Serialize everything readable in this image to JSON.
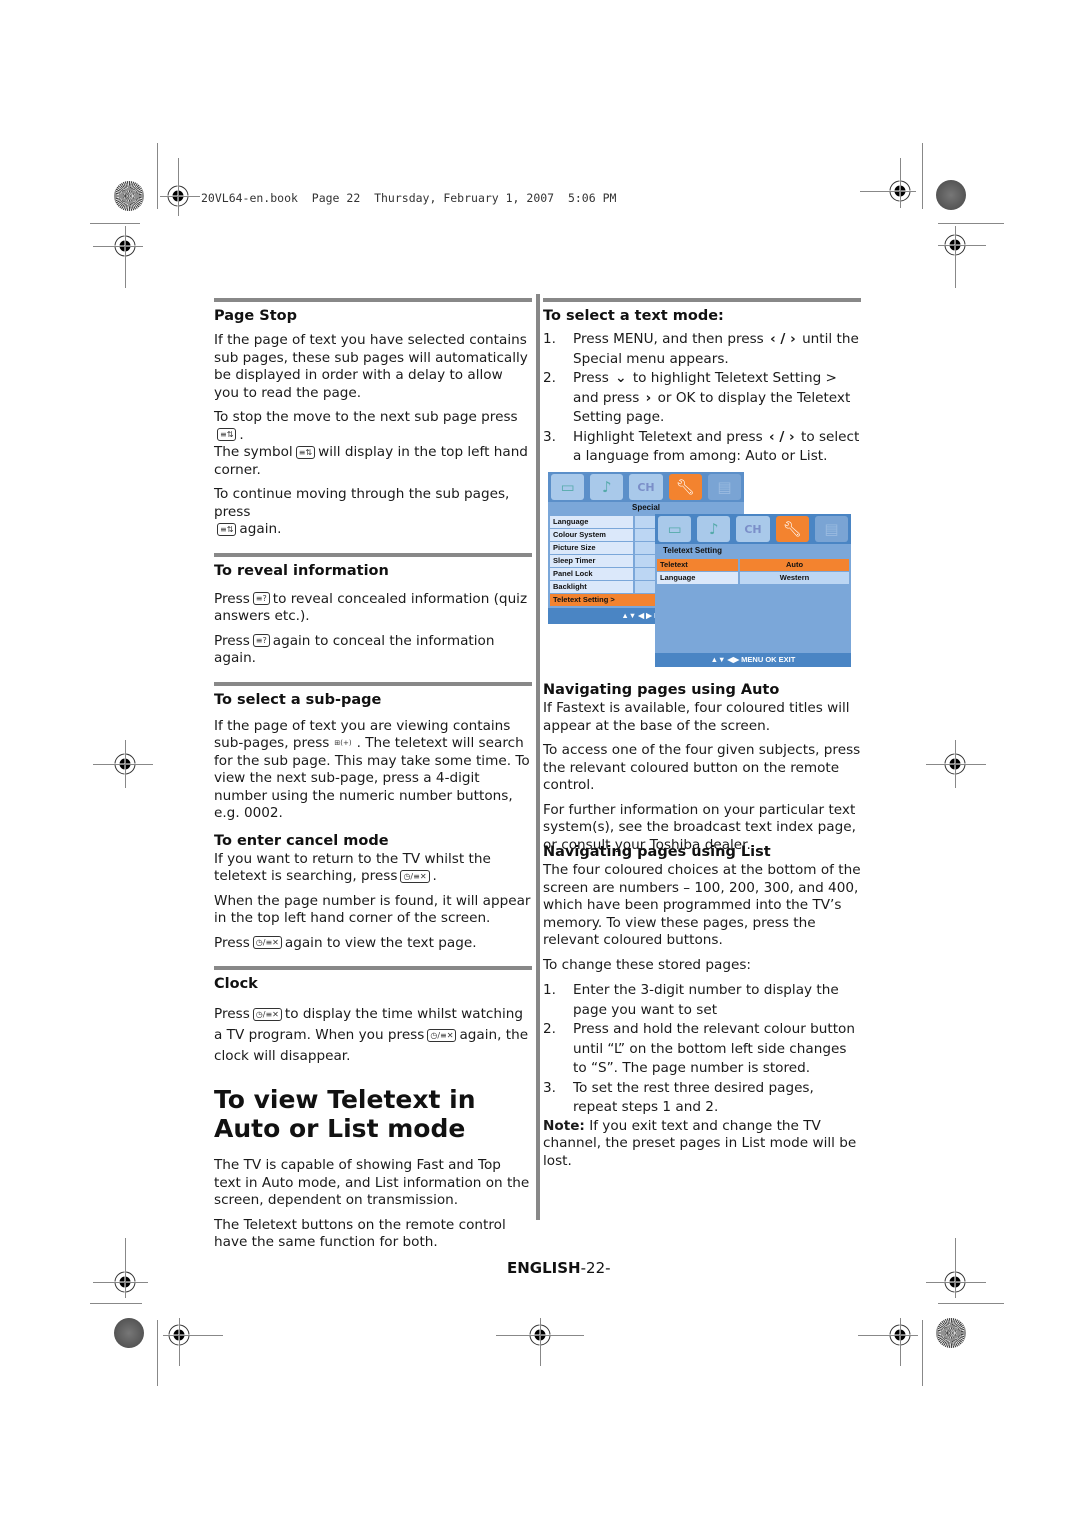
{
  "print_header": "20VL64-en.book  Page 22  Thursday, February 1, 2007  5:06 PM",
  "left_column": {
    "page_stop": {
      "title": "Page Stop",
      "p1": "If the page of text you have selected contains sub pages, these sub pages will automatically be displayed in order with a delay to allow you to read the page.",
      "p2_a": "To stop the move to the next sub page press",
      "p2_b": ".",
      "p3_a": "The symbol",
      "p3_b": "will display in the top left hand corner.",
      "p4_a": "To continue moving through the sub pages, press",
      "p4_b": "again.",
      "icon_label": "hold-icon"
    },
    "reveal": {
      "title": "To reveal information",
      "p1_a": "Press",
      "p1_b": "to reveal concealed information (quiz answers etc.).",
      "p2_a": "Press",
      "p2_b": "again to conceal the information again."
    },
    "subpage": {
      "title": "To select a sub-page",
      "p1_a": "If the page of text you are viewing contains sub-pages, press",
      "p1_b": ". The teletext will search for the sub page. This may take some time. To view the next sub-page, press a 4-digit number using the numeric number buttons, e.g. 0002."
    },
    "cancel": {
      "title": "To enter cancel mode",
      "p1_a": "If you want to return to the TV whilst the teletext is searching, press",
      "p1_b": ".",
      "p2": "When the page number is found, it will appear in the top left hand corner of the screen.",
      "p3_a": "Press",
      "p3_b": "again to view the text page."
    },
    "clock": {
      "title": "Clock",
      "p1_a": "Press",
      "p1_b": "to display the time whilst watching a TV program. When you press",
      "p1_c": "again, the clock will disappear."
    },
    "auto_list": {
      "title": "To view Teletext in Auto or List mode",
      "p1": "The TV is capable of showing Fast and Top text in Auto mode, and List information on the screen, dependent on transmission.",
      "p2": "The Teletext buttons on the remote control have the same function for both."
    }
  },
  "icons": {
    "hold": "≡⇅",
    "reveal": "≡?",
    "subpage": "⊞(+)",
    "cancel": "◷/≡✕"
  },
  "right_column": {
    "text_mode": {
      "title": "To select a text mode:",
      "steps": [
        {
          "num": "1.",
          "a": "Press MENU, and then press",
          "arrows": "‹ / ›",
          "b": "until the Special menu appears."
        },
        {
          "num": "2.",
          "a": "Press",
          "arrows": "⌄",
          "b": "to highlight Teletext Setting > and press",
          "arrows2": "›",
          "c": "or OK to display the Teletext Setting page."
        },
        {
          "num": "3.",
          "a": "Highlight Teletext and press",
          "arrows": "‹ / ›",
          "b": "to select a language from among: Auto or List."
        }
      ]
    },
    "menu_special": {
      "title": "Special",
      "items": [
        "Language",
        "Colour System",
        "Picture Size",
        "Sleep Timer",
        "Panel Lock",
        "Backlight",
        "Teletext Setting >"
      ],
      "highlighted": "Teletext Setting >",
      "footer": "▲▼ ◀ ▶ MEN"
    },
    "menu_teletext": {
      "title": "Teletext Setting",
      "rows": [
        {
          "label": "Teletext",
          "value": "Auto"
        },
        {
          "label": "Language",
          "value": "Western"
        }
      ],
      "footer": "▲▼ ◀▶ MENU  OK  EXIT"
    },
    "nav_auto": {
      "title": "Navigating pages using Auto",
      "p1": "If Fastext is available, four coloured titles will appear at the base of the screen.",
      "p2": "To access one of the four given subjects, press the relevant coloured button on the remote control.",
      "p3": "For further information on your particular text system(s), see the broadcast text index page, or consult your Toshiba dealer."
    },
    "nav_list": {
      "title": "Navigating pages using List",
      "p1": "The four coloured choices at the bottom of the screen are numbers – 100, 200, 300, and 400, which have been programmed into the TV’s memory. To view these pages, press the relevant coloured buttons.",
      "p2": "To change these stored pages:",
      "steps": [
        {
          "num": "1.",
          "text": "Enter the 3-digit number to display the page you want to set"
        },
        {
          "num": "2.",
          "text": "Press and hold the relevant colour button until “L” on the bottom left side changes to “S”. The page number is stored."
        },
        {
          "num": "3.",
          "text": "To set the rest three desired pages, repeat steps 1 and 2."
        }
      ],
      "note_label": "Note:",
      "note_text": " If you exit text and change the TV channel, the preset pages in List mode will be lost."
    }
  },
  "footer": {
    "lang": "ENGLISH",
    "page": "-22-"
  }
}
